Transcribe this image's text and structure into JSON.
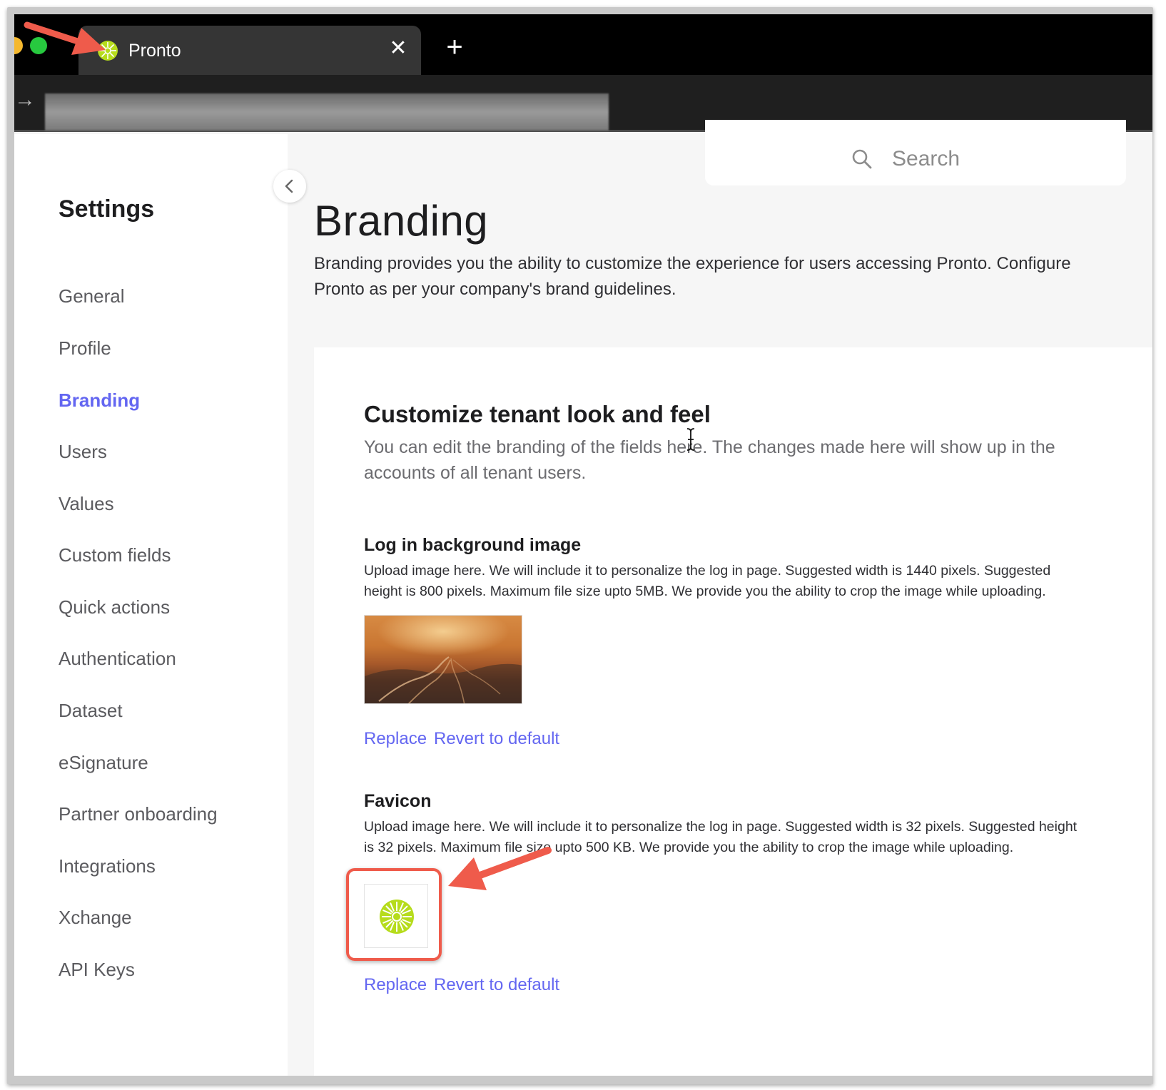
{
  "browser": {
    "tab_title": "Pronto",
    "tab_close": "✕",
    "new_tab": "+"
  },
  "sidebar": {
    "title": "Settings",
    "items": [
      {
        "label": "General"
      },
      {
        "label": "Profile"
      },
      {
        "label": "Branding",
        "active": true
      },
      {
        "label": "Users"
      },
      {
        "label": "Values"
      },
      {
        "label": "Custom fields"
      },
      {
        "label": "Quick actions"
      },
      {
        "label": "Authentication"
      },
      {
        "label": "Dataset"
      },
      {
        "label": "eSignature"
      },
      {
        "label": "Partner onboarding"
      },
      {
        "label": "Integrations"
      },
      {
        "label": "Xchange"
      },
      {
        "label": "API Keys"
      }
    ]
  },
  "search": {
    "placeholder": "Search"
  },
  "page": {
    "title": "Branding",
    "description": "Branding provides you the ability to customize the experience for users accessing Pronto. Configure Pronto as per your company's brand guidelines."
  },
  "card": {
    "title": "Customize tenant look and feel",
    "description": "You can edit the branding of the fields here. The changes made here will show up in the accounts of all tenant users."
  },
  "sections": {
    "login_bg": {
      "title": "Log in background image",
      "description": "Upload image here. We will include it to personalize the log in page. Suggested width is 1440 pixels. Suggested height is 800 pixels. Maximum file size upto 5MB. We provide you the ability to crop the image while uploading.",
      "replace": "Replace",
      "revert": "Revert to default"
    },
    "favicon": {
      "title": "Favicon",
      "description": "Upload image here. We will include it to personalize the log in page. Suggested width is 32 pixels. Suggested height is 32 pixels. Maximum file size upto 500 KB. We provide you the ability to crop the image while uploading.",
      "replace": "Replace",
      "revert": "Revert to default"
    }
  },
  "colors": {
    "accent": "#6366f1",
    "annotation": "#ef5b4b",
    "favicon_green": "#b6dc1c"
  },
  "icons": {
    "favicon": "pronto-logo-icon",
    "search": "search-icon",
    "collapse": "chevron-left-icon"
  }
}
